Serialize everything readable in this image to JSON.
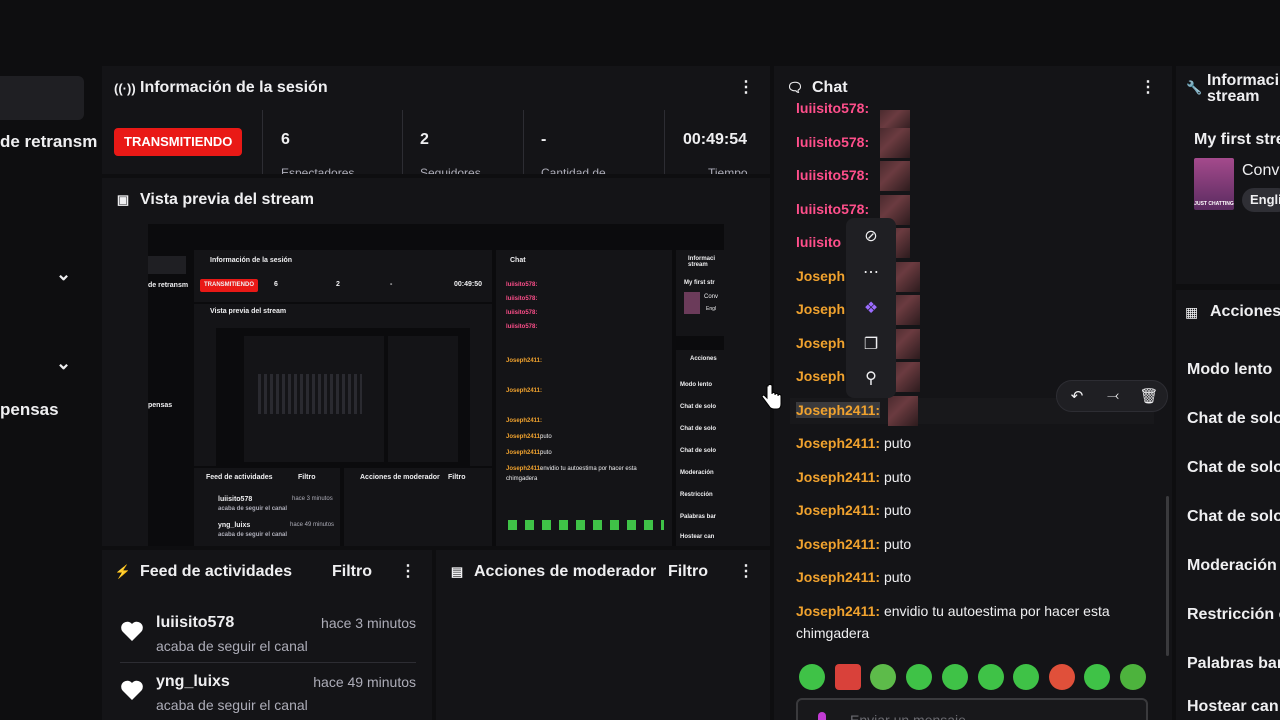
{
  "left": {
    "items": [
      "de retransm",
      "pensas"
    ]
  },
  "session": {
    "title": "Información de la sesión",
    "live_badge": "TRANSMITIENDO",
    "stats": [
      {
        "value": "6",
        "label": "Espectadores"
      },
      {
        "value": "2",
        "label": "Seguidores"
      },
      {
        "value": "-",
        "label": "Cantidad de"
      },
      {
        "value": "00:49:54",
        "label": "Tiempo"
      }
    ]
  },
  "preview": {
    "title": "Vista previa del stream",
    "mini": {
      "session_title": "Información de la sesión",
      "live_badge": "TRANSMITIENDO",
      "stat1": "6",
      "stat2": "2",
      "stat3": "-",
      "stat4": "00:49:50",
      "left_item1": "de retransm",
      "left_item2": "pensas",
      "preview_title": "Vista previa del stream",
      "feed_title": "Feed de actividades",
      "feed_filter": "Filtro",
      "mod_title": "Acciones de moderador",
      "mod_filter": "Filtro",
      "feed1_user": "luiisito578",
      "feed1_time": "hace 3 minutos",
      "feed1_sub": "acaba de seguir el canal",
      "feed2_user": "yng_luixs",
      "feed2_time": "hace 49 minutos",
      "feed2_sub": "acaba de seguir el canal",
      "chat_title": "Chat",
      "chat_user1": "luiisito578:",
      "chat_user2": "Joseph2411:",
      "chat_msg": "puto",
      "chat_long": "envidio tu autoestima por hacer esta",
      "chat_long2": "chimgadera",
      "right_title": "Informaci stream",
      "right_first": "My first str",
      "right_conv": "Conv",
      "right_engl": "Engl",
      "acciones": "Acciones",
      "a1": "Modo lento",
      "a2": "Chat de solo",
      "a3": "Chat de solo",
      "a4": "Chat de solo",
      "a5": "Moderación",
      "a6": "Restricción",
      "a7": "Palabras bar",
      "a8": "Hostear can"
    }
  },
  "feed": {
    "title": "Feed de actividades",
    "filter": "Filtro",
    "items": [
      {
        "user": "luiisito578",
        "time": "hace 3 minutos",
        "sub": "acaba de seguir el canal"
      },
      {
        "user": "yng_luixs",
        "time": "hace 49 minutos",
        "sub": "acaba de seguir el canal"
      }
    ]
  },
  "mod": {
    "title": "Acciones de moderador",
    "filter": "Filtro"
  },
  "chat": {
    "title": "Chat",
    "messages": [
      {
        "user": "luiisito578:",
        "msg": "",
        "color": "#ff4f8b"
      },
      {
        "user": "luiisito578:",
        "msg": "",
        "color": "#ff4f8b"
      },
      {
        "user": "luiisito578:",
        "msg": "",
        "color": "#ff4f8b"
      },
      {
        "user": "luiisito578:",
        "msg": "",
        "color": "#ff4f8b"
      },
      {
        "user": "luiisito",
        "msg": "",
        "color": "#ff4f8b"
      },
      {
        "user": "Joseph",
        "msg": "",
        "color": "#f0a22e"
      },
      {
        "user": "Joseph",
        "msg": "",
        "color": "#f0a22e"
      },
      {
        "user": "Joseph",
        "msg": "",
        "color": "#f0a22e"
      },
      {
        "user": "Joseph",
        "msg": "",
        "color": "#f0a22e"
      },
      {
        "user": "Joseph2411:",
        "msg": "",
        "color": "#f0a22e"
      },
      {
        "user": "Joseph2411:",
        "msg": "puto",
        "color": "#f0a22e"
      },
      {
        "user": "Joseph2411:",
        "msg": "puto",
        "color": "#f0a22e"
      },
      {
        "user": "Joseph2411:",
        "msg": "puto",
        "color": "#f0a22e"
      },
      {
        "user": "Joseph2411:",
        "msg": "puto",
        "color": "#f0a22e"
      },
      {
        "user": "Joseph2411:",
        "msg": "puto",
        "color": "#f0a22e"
      },
      {
        "user": "Joseph2411:",
        "msg": "envidio tu autoestima por hacer esta",
        "color": "#f0a22e"
      }
    ],
    "last_msg_line2": "chimgadera",
    "input_placeholder": "Enviar un mensaje"
  },
  "right": {
    "info_title_1": "Informaci",
    "info_title_2": "stream",
    "stream_title": "My first stre",
    "category": "Conv",
    "tag": "Engli",
    "thumb_text": "JUST CHATTING",
    "actions_title": "Acciones",
    "actions": [
      "Modo lento",
      "Chat de solo",
      "Chat de solo",
      "Chat de solo",
      "Moderación",
      "Restricción c",
      "Palabras bar",
      "Hostear can"
    ]
  },
  "colors": {
    "bg": "#0e0e10",
    "panel": "#141417",
    "live": "#e91916",
    "user_pink": "#ff4f8b",
    "user_orange": "#f0a22e",
    "emote_green": "#3fc247"
  }
}
